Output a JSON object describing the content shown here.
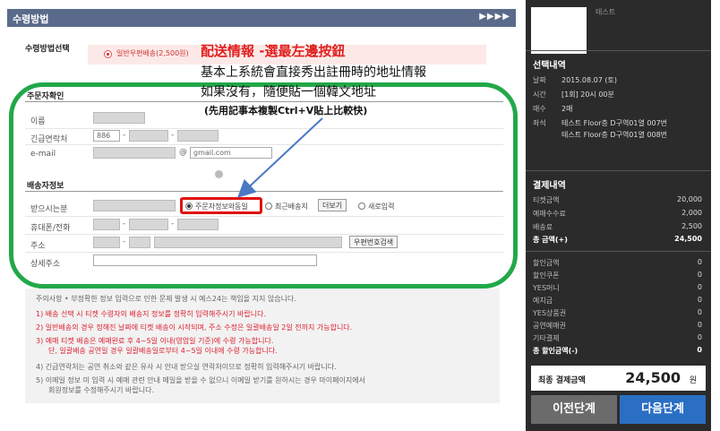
{
  "header": {
    "title": "수령방법",
    "arrows": "▶▶▶▶"
  },
  "method": {
    "label": "수령방법선택",
    "option": "일반우편배송(2,500원)"
  },
  "annotation": {
    "line1": "配送情報 -選最左邊按鈕",
    "line2": "基本上系統會直接秀出註冊時的地址情報",
    "line3": "如果沒有，隨便貼一個韓文地址",
    "line4": "(先用記事本複製Ctrl+V貼上比較快)"
  },
  "orderer": {
    "title": "주문자확인",
    "name_label": "이름",
    "phone_label": "긴급연락처",
    "phone_prefix": "886",
    "email_label": "e-mail",
    "email_domain": "gmail.com",
    "at": "@"
  },
  "delivery": {
    "title": "배송자정보",
    "recipient_label": "받으시는분",
    "opt_same": "주문자정보와동일",
    "opt_recent": "최근배송지",
    "more_btn": "더보기",
    "opt_new": "새로입력",
    "mobile_label": "휴대폰/전화",
    "address_label": "주소",
    "zip_btn": "우편번호검색",
    "detail_label": "상세주소"
  },
  "notice": {
    "line0": "주의사항 • 부정확한 정보 입력으로 인한 문제 발생 시 예스24는 책임을 지지 않습니다.",
    "line1": "1) 배송 선택 시 티켓 수령자의 배송지 정보를 정확히 입력해주시기 바랍니다.",
    "line2": "2) 일반배송의 경우 정해진 날짜에 티켓 배송이 시작되며, 주소 수정은 일괄배송일 2일 전까지 가능합니다.",
    "line3": "3) 예매 티켓 배송은 예매완료 후 4~5일 이내(영업일 기준)에 수령 가능합니다.",
    "line3b": "단, 일괄배송 공연일 경우 일괄배송일로부터 4~5일 이내에 수령 가능합니다.",
    "line4": "4) 긴급연락처는 공연 취소와 같은 유사 시 안내 받으실 연락처이므로 정확히 입력해주시기 바랍니다.",
    "line5": "5) 이메일 정보 미 입력 시 예매 관련 안내 메일을 받을 수 없으니 이메일 받기를 원하시는 경우 마이페이지에서",
    "line5b": "회원정보를 수정해주시기 바랍니다."
  },
  "sidebar": {
    "thumb_text": "테스트",
    "booking_title": "선택내역",
    "date_key": "날짜",
    "date_val": "2015.08.07 (토)",
    "time_key": "시간",
    "time_val": "[1회] 20시 00분",
    "count_key": "매수",
    "count_val": "2매",
    "seat_key": "좌석",
    "seat_val1": "테스트 Floor층 D구역01열 007번",
    "seat_val2": "테스트 Floor층 D구역01열 008번",
    "pay_title": "결제내역",
    "ticket_key": "티켓금액",
    "ticket_val": "20,000",
    "fee_key": "예매수수료",
    "fee_val": "2,000",
    "ship_key": "배송료",
    "ship_val": "2,500",
    "total_key": "총 금액(+)",
    "total_val": "24,500",
    "d1_key": "할인금액",
    "d1_val": "0",
    "d2_key": "할인쿠폰",
    "d2_val": "0",
    "d3_key": "YES머니",
    "d3_val": "0",
    "d4_key": "예치금",
    "d4_val": "0",
    "d5_key": "YES상품권",
    "d5_val": "0",
    "d6_key": "공연예매권",
    "d6_val": "0",
    "d7_key": "기타결제",
    "d7_val": "0",
    "d8_key": "총 할인금액(-)",
    "d8_val": "0",
    "final_label": "최종 결제금액",
    "final_amount": "24,500",
    "final_unit": "원",
    "prev_btn": "이전단계",
    "next_btn": "다음단계"
  }
}
